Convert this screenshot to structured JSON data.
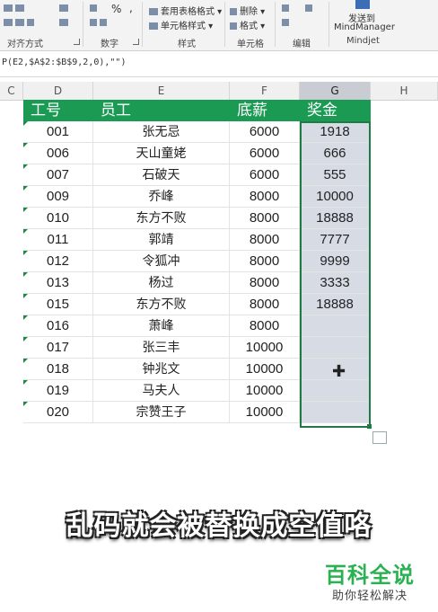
{
  "ribbon": {
    "percent_symbol": "%",
    "comma_symbol": ",",
    "conditional_format": "套用表格格式 ▾",
    "cell_style": "单元格样式 ▾",
    "delete": "删除 ▾",
    "format": "格式 ▾",
    "send_to": "发送到",
    "mindmanager": "MindManager",
    "groups": {
      "alignment": "对齐方式",
      "number": "数字",
      "styles": "样式",
      "cells": "单元格",
      "editing": "编辑",
      "mindjet": "Mindjet"
    }
  },
  "formula": {
    "text": "P(E2,$A$2:$B$9,2,0),\"\")"
  },
  "columns": [
    "C",
    "D",
    "E",
    "F",
    "G",
    "H"
  ],
  "table": {
    "headers": [
      "工号",
      "员工",
      "底薪",
      "奖金"
    ],
    "rows": [
      [
        "001",
        "张无忌",
        "6000",
        "1918"
      ],
      [
        "006",
        "天山童姥",
        "6000",
        "666"
      ],
      [
        "007",
        "石破天",
        "6000",
        "555"
      ],
      [
        "009",
        "乔峰",
        "8000",
        "10000"
      ],
      [
        "010",
        "东方不败",
        "8000",
        "18888"
      ],
      [
        "011",
        "郭靖",
        "8000",
        "7777"
      ],
      [
        "012",
        "令狐冲",
        "8000",
        "9999"
      ],
      [
        "013",
        "杨过",
        "8000",
        "3333"
      ],
      [
        "015",
        "东方不败",
        "8000",
        "18888"
      ],
      [
        "016",
        "萧峰",
        "8000",
        ""
      ],
      [
        "017",
        "张三丰",
        "10000",
        ""
      ],
      [
        "018",
        "钟兆文",
        "10000",
        ""
      ],
      [
        "019",
        "马夫人",
        "10000",
        ""
      ],
      [
        "020",
        "宗赞王子",
        "10000",
        ""
      ]
    ]
  },
  "caption": "乱码就会被替换成空值咯",
  "watermark": {
    "logo": "百科全说",
    "subtitle": "助你轻松解决"
  },
  "colors": {
    "header_green": "#1a9a52",
    "selection_border": "#1f7a45",
    "selected_fill": "#d7dbe4",
    "watermark_green": "#2bb152"
  }
}
